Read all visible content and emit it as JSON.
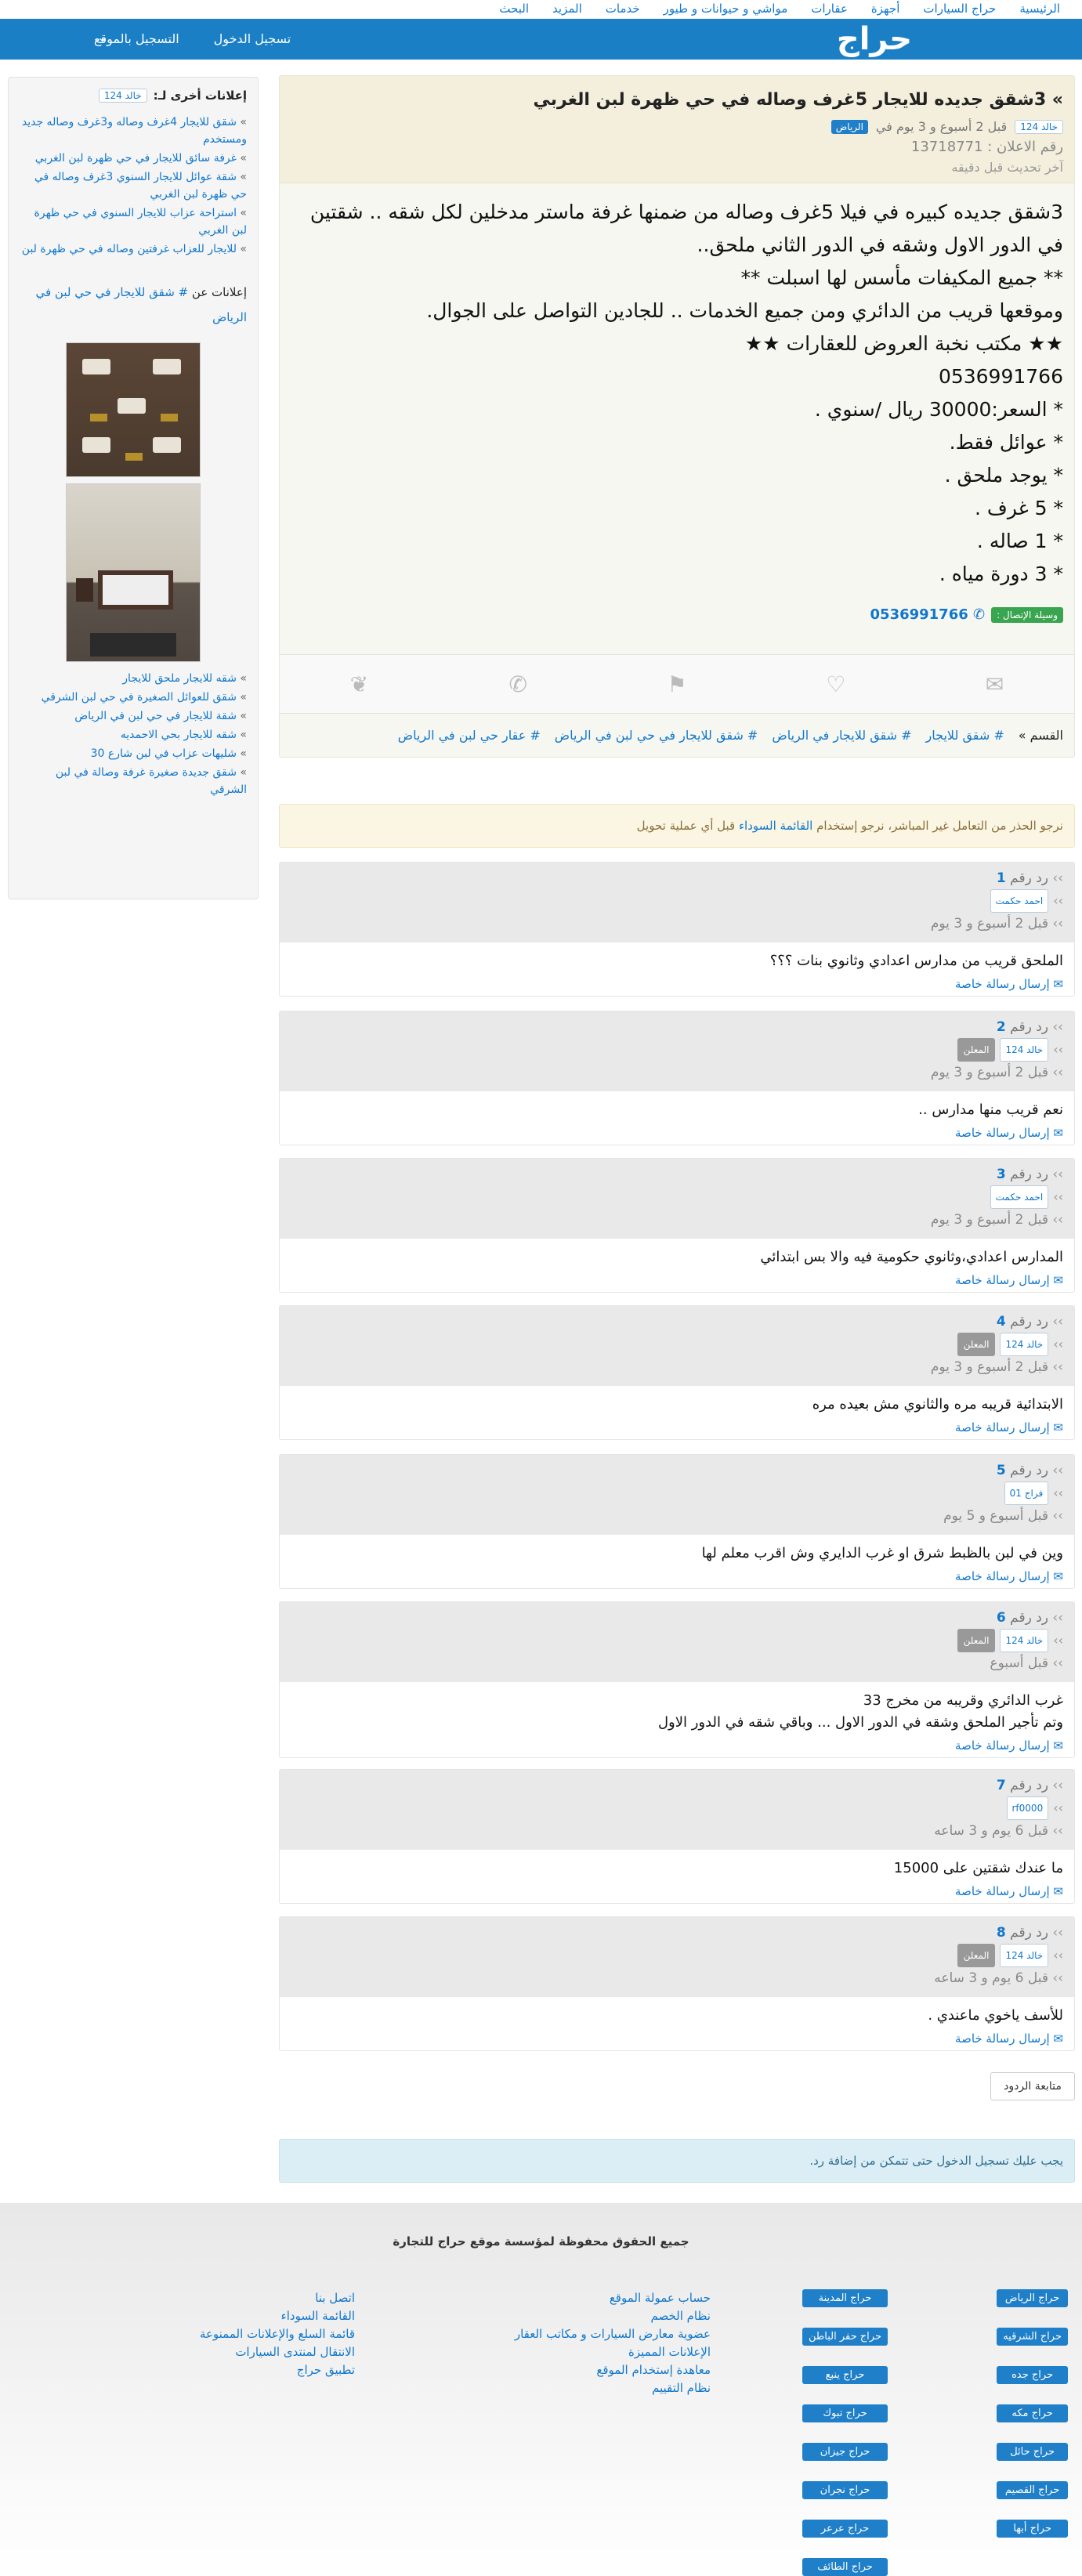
{
  "topnav": [
    "الرئيسية",
    "حراج السيارات",
    "أجهزة",
    "عقارات",
    "مواشي و حيوانات و طيور",
    "خدمات",
    "المزيد",
    "البحث"
  ],
  "header": {
    "logo": "حراج",
    "login": "تسجيل الدخول",
    "register": "التسجيل بالموقع"
  },
  "sidebar": {
    "other_ads_label": "إعلانات أخرى لـ:",
    "user": "خالد 124",
    "other_ads": [
      "شقق للايجار 4غرف وصاله و3غرف وصاله جديد ومستخدم",
      "غرفة سائق للايجار في حي ظهرة لبن الغربي",
      "شقة عوائل للايجار السنوي 3غرف وصاله في حي ظهرة لبن الغربي",
      "استراحة عزاب للايجار السنوي في حي ظهرة لبن الغربي",
      "للايجار للعزاب غرفتين وصاله في حي ظهرة لبن"
    ],
    "tag_ads_label": "إعلانات عن",
    "tag_ads_link": "# شقق للايجار في حي لبن في الرياض",
    "related": [
      "شقه للايجار ملحق للايجار",
      "شقق للعوائل الصغيرة في حي لبن الشرقي",
      "شقة للايجار في حي لبن في الرياض",
      "شقه للايجار بحي الاحمديه",
      "شليهات عزاب في لبن شارع 30",
      "شقق جديدة صغيرة غرفة وصالة في لبن الشرقي"
    ]
  },
  "post": {
    "title": "3شقق جديده للايجار 5غرف وصاله في حي ظهرة لبن الغربي",
    "city": "الرياض",
    "time": "قبل 2 أسبوع و 3 يوم في",
    "user": "خالد 124",
    "ad_number": "رقم الاعلان : 13718771",
    "updated": "آخر تحديث قبل دقيقه",
    "body": [
      "3شقق جديده كبيره في فيلا 5غرف وصاله من ضمنها غرفة ماستر مدخلين لكل شقه .. شقتين في الدور الاول وشقه في الدور الثاني ملحق..",
      "** جميع المكيفات مأسس لها اسبلت **",
      "وموقعها قريب من الدائري ومن جميع الخدمات .. للجادين التواصل على الجوال.",
      "★★ مكتب نخبة العروض للعقارات ★★",
      "0536991766",
      "* السعر:30000 ريال /سنوي .",
      "* عوائل فقط.",
      "* يوجد ملحق .",
      "* 5 غرف .",
      "* 1 صاله .",
      "* 3 دورة مياه ."
    ],
    "contact_label": "وسيلة الإتصال :",
    "phone": "0536991766",
    "category_label": "القسم »",
    "categories": [
      "# شقق للايجار",
      "# شقق للايجار في الرياض",
      "# شقق للايجار في حي لبن في الرياض",
      "# عقار حي لبن في الرياض"
    ]
  },
  "warning": {
    "text_before": "نرجو الحذر من التعامل غير المباشر، نرجو إستخدام ",
    "link": "القائمة السوداء",
    "text_after": " قبل أي عملية تحويل"
  },
  "reply_prefix": "رد رقم",
  "private_msg": "إرسال رسالة خاصة",
  "owner_label": "المعلن",
  "replies": [
    {
      "num": "1",
      "user": "احمد حكمت",
      "owner": false,
      "time": "قبل 2 أسبوع و 3 يوم",
      "text": "الملحق قريب من مدارس اعدادي وثانوي بنات ؟؟؟"
    },
    {
      "num": "2",
      "user": "خالد 124",
      "owner": true,
      "time": "قبل 2 أسبوع و 3 يوم",
      "text": "نعم قريب منها مدارس .."
    },
    {
      "num": "3",
      "user": "احمد حكمت",
      "owner": false,
      "time": "قبل 2 أسبوع و 3 يوم",
      "text": "المدارس اعدادي،وثانوي حكومية فيه والا بس ابتدائي"
    },
    {
      "num": "4",
      "user": "خالد 124",
      "owner": true,
      "time": "قبل 2 أسبوع و 3 يوم",
      "text": "الابتدائية قريبه مره والثانوي مش بعيده مره"
    },
    {
      "num": "5",
      "user": "فراج 01",
      "owner": false,
      "time": "قبل أسبوع و 5 يوم",
      "text": "وين في لبن بالظبط شرق او غرب الدايري وش اقرب معلم لها"
    },
    {
      "num": "6",
      "user": "خالد 124",
      "owner": true,
      "time": "قبل أسبوع",
      "text": "غرب الدائري وقريبه من مخرج 33\nوتم تأجير الملحق وشقه في الدور الاول ... وباقي شقه في الدور الاول"
    },
    {
      "num": "7",
      "user": "rf0000",
      "owner": false,
      "time": "قبل 6 يوم و 3 ساعه",
      "text": "ما عندك شقتين على 15000"
    },
    {
      "num": "8",
      "user": "خالد 124",
      "owner": true,
      "time": "قبل 6 يوم و 3 ساعه",
      "text": "للأسف ياخوي ماعندي ."
    }
  ],
  "follow_button": "متابعة الردود",
  "login_note": "يجب عليك تسجيل الدخول حتى تتمكن من إضافة رد.",
  "footer": {
    "copyright": "جميع الحقوق محفوظة لمؤسسة موقع حراج للتجارة",
    "col1": [
      "حراج الرياض",
      "حراج الشرقيه",
      "حراج جده",
      "حراج مكه",
      "حراج حائل",
      "حراج القصيم",
      "حراج أبها"
    ],
    "col2": [
      "حراج المدينة",
      "حراج حفر الباطن",
      "حراج ينبع",
      "حراج تبوك",
      "حراج جيزان",
      "حراج نجران",
      "حراج عرعر",
      "حراج الطائف"
    ],
    "col3": [
      "حساب عمولة الموقع",
      "نظام الخصم",
      "عضوية معارض السيارات و مكاتب العقار",
      "الإعلانات المميزة",
      "معاهدة إستخدام الموقع",
      "نظام التقييم"
    ],
    "col4": [
      "اتصل بنا",
      "القائمة السوداء",
      "قائمة السلع والإعلانات الممنوعة",
      "الانتقال لمنتدى السيارات",
      "تطبيق حراج"
    ]
  },
  "colors": {
    "brand_blue": "#1b7fc6",
    "owner_gray": "#999999",
    "contact_green": "#3aa550"
  }
}
